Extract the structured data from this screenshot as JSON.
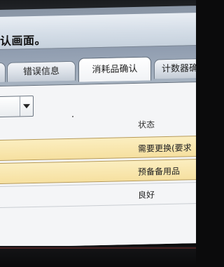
{
  "title": "认画面。",
  "tabs": [
    {
      "label": ""
    },
    {
      "label": "错误信息"
    },
    {
      "label": "消耗品确认"
    },
    {
      "label": "计数器确"
    }
  ],
  "active_tab": "消耗品确认",
  "table": {
    "status_header": "状态",
    "rows": [
      {
        "status": "需要更换(要求",
        "highlight": true
      },
      {
        "status": "预备备用品",
        "highlight": true
      },
      {
        "status": "良好",
        "highlight": false
      }
    ]
  },
  "colors": {
    "highlight_row": "#f6e0a0",
    "title_bar": "#d4dde7",
    "tab_strip": "#a7b3c1"
  }
}
